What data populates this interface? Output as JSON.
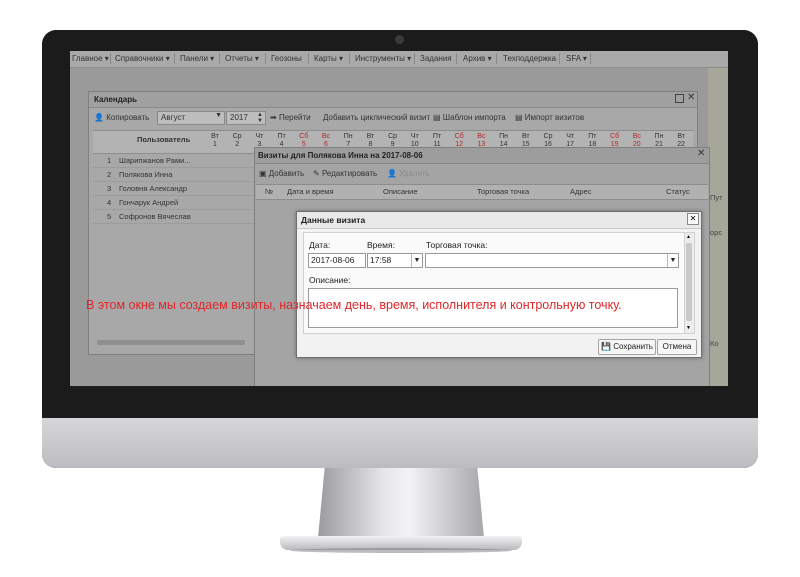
{
  "menu": [
    "Главное ▾",
    "Справочники ▾",
    "Панели ▾",
    "Отчеты ▾",
    "Геозоны",
    "Карты ▾",
    "Инструменты ▾",
    "Задания",
    "Архив ▾",
    "Техподдержка",
    "SFA ▾"
  ],
  "calendar": {
    "title": "Календарь",
    "copy_label": "Копировать",
    "month": "Август",
    "year": "2017",
    "goto_label": "Перейти",
    "add_cyclic_label": "Добавить циклический визит",
    "import_template_label": "Шаблон импорта",
    "import_visits_label": "Импорт визитов",
    "user_col": "Пользователь",
    "day_headers": [
      {
        "d": "Вт",
        "n": "1"
      },
      {
        "d": "Ср",
        "n": "2"
      },
      {
        "d": "Чт",
        "n": "3"
      },
      {
        "d": "Пт",
        "n": "4"
      },
      {
        "d": "Сб",
        "n": "5",
        "we": true
      },
      {
        "d": "Вс",
        "n": "6",
        "we": true
      },
      {
        "d": "Пн",
        "n": "7"
      },
      {
        "d": "Вт",
        "n": "8"
      },
      {
        "d": "Ср",
        "n": "9"
      },
      {
        "d": "Чт",
        "n": "10"
      },
      {
        "d": "Пт",
        "n": "11"
      },
      {
        "d": "Сб",
        "n": "12",
        "we": true
      },
      {
        "d": "Вс",
        "n": "13",
        "we": true
      },
      {
        "d": "Пн",
        "n": "14"
      },
      {
        "d": "Вт",
        "n": "15"
      },
      {
        "d": "Ср",
        "n": "16"
      },
      {
        "d": "Чт",
        "n": "17"
      },
      {
        "d": "Пт",
        "n": "18"
      },
      {
        "d": "Сб",
        "n": "19",
        "we": true
      },
      {
        "d": "Вс",
        "n": "20",
        "we": true
      },
      {
        "d": "Пн",
        "n": "21"
      },
      {
        "d": "Вт",
        "n": "22"
      }
    ],
    "rows": [
      {
        "n": "1",
        "name": "Шарипжанов Рами..."
      },
      {
        "n": "2",
        "name": "Полякова Инна"
      },
      {
        "n": "3",
        "name": "Головня Александр"
      },
      {
        "n": "4",
        "name": "Гончарук Андрей"
      },
      {
        "n": "5",
        "name": "Софронов Вячеслав"
      }
    ]
  },
  "visits": {
    "title": "Визиты для Поляковa Инна на 2017-08-06",
    "add_label": "Добавить",
    "edit_label": "Редактировать",
    "delete_label": "Удалить",
    "columns": [
      "№",
      "Дата и время",
      "Описание",
      "Торговая точка",
      "Адрес",
      "Статус"
    ]
  },
  "map_labels": [
    "Пут",
    "орс",
    "Ко"
  ],
  "dialog": {
    "title": "Данные визита",
    "date_label": "Дата:",
    "date_value": "2017-08-06",
    "time_label": "Время:",
    "time_value": "17:58",
    "point_label": "Торговая точка:",
    "point_value": "",
    "desc_label": "Описание:",
    "save_label": "Сохранить",
    "cancel_label": "Отмена"
  },
  "caption": "В этом окне мы создаем визиты, назначаем день, время, исполнителя и контрольную точку."
}
